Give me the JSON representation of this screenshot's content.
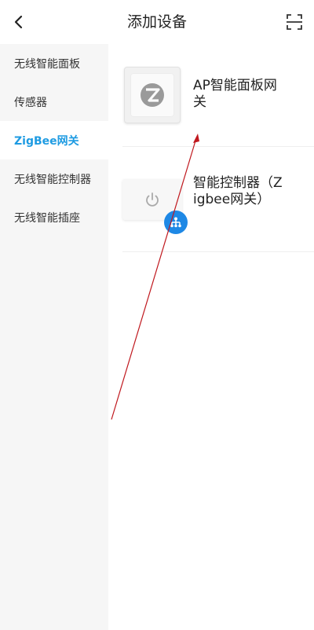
{
  "header": {
    "title": "添加设备",
    "back_icon": "chevron-left-icon",
    "scan_icon": "scan-icon"
  },
  "sidebar": {
    "items": [
      {
        "label": "无线智能面板"
      },
      {
        "label": "传感器"
      },
      {
        "label": "ZigBee网关",
        "active": true
      },
      {
        "label": "无线智能控制器"
      },
      {
        "label": "无线智能插座"
      }
    ]
  },
  "devices": [
    {
      "name": "AP智能面板网关",
      "icon": "zigbee-logo-icon"
    },
    {
      "name": "智能控制器（Zigbee网关）",
      "icon": "power-icon",
      "badge_icon": "hub-network-icon"
    }
  ],
  "colors": {
    "accent": "#1e9be2",
    "badge": "#1e88e5",
    "sidebar_bg": "#f6f6f6",
    "annotation_arrow": "#c0181e"
  }
}
